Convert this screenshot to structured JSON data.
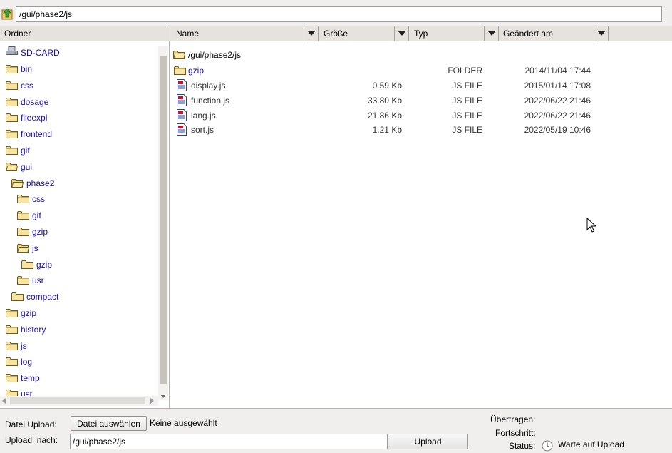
{
  "path_bar": {
    "current_path": "/gui/phase2/js"
  },
  "tree": {
    "header": "Ordner",
    "items": [
      {
        "label": "SD-CARD",
        "icon": "drive-icon"
      },
      {
        "label": "bin",
        "icon": "folder-icon"
      },
      {
        "label": "css",
        "icon": "folder-icon"
      },
      {
        "label": "dosage",
        "icon": "folder-icon"
      },
      {
        "label": "fileexpl",
        "icon": "folder-icon"
      },
      {
        "label": "frontend",
        "icon": "folder-icon"
      },
      {
        "label": "gif",
        "icon": "folder-icon"
      },
      {
        "label": "gui",
        "icon": "folder-open-icon"
      },
      {
        "label": "phase2",
        "icon": "folder-open-icon"
      },
      {
        "label": "css",
        "icon": "folder-icon"
      },
      {
        "label": "gif",
        "icon": "folder-icon"
      },
      {
        "label": "gzip",
        "icon": "folder-icon"
      },
      {
        "label": "js",
        "icon": "folder-open-icon"
      },
      {
        "label": "gzip",
        "icon": "folder-icon"
      },
      {
        "label": "usr",
        "icon": "folder-icon"
      },
      {
        "label": "compact",
        "icon": "folder-icon"
      },
      {
        "label": "gzip",
        "icon": "folder-icon"
      },
      {
        "label": "history",
        "icon": "folder-icon"
      },
      {
        "label": "js",
        "icon": "folder-icon"
      },
      {
        "label": "log",
        "icon": "folder-icon"
      },
      {
        "label": "temp",
        "icon": "folder-icon"
      },
      {
        "label": "usr",
        "icon": "folder-icon"
      }
    ]
  },
  "columns": {
    "name": "Name",
    "size": "Größe",
    "type": "Typ",
    "modified": "Geändert am"
  },
  "file_list": {
    "current_folder": "/gui/phase2/js",
    "rows": [
      {
        "name": "gzip",
        "size": "",
        "type": "FOLDER",
        "modified": "2014/11/04 17:44",
        "icon": "folder-icon"
      },
      {
        "name": "display.js",
        "size": "0.59 Kb",
        "type": "JS FILE",
        "modified": "2015/01/14 17:08",
        "icon": "js-file-icon"
      },
      {
        "name": "function.js",
        "size": "33.80 Kb",
        "type": "JS FILE",
        "modified": "2022/06/22 21:46",
        "icon": "js-file-icon"
      },
      {
        "name": "lang.js",
        "size": "21.86 Kb",
        "type": "JS FILE",
        "modified": "2022/06/22 21:46",
        "icon": "js-file-icon"
      },
      {
        "name": "sort.js",
        "size": "1.21 Kb",
        "type": "JS FILE",
        "modified": "2022/05/19 10:46",
        "icon": "js-file-icon"
      }
    ]
  },
  "upload": {
    "file_label": "Datei Upload:",
    "choose_button": "Datei auswählen",
    "no_file": "Keine ausgewählt",
    "target_label": "Upload  nach:",
    "target_path": "/gui/phase2/js",
    "upload_button": "Upload",
    "transferred_label": "Übertragen:",
    "progress_label": "Fortschritt:",
    "status_label": "Status:",
    "status_text": "Warte auf Upload"
  },
  "colors": {
    "link": "#1a0dab",
    "folder": "#f3d77a",
    "toolbar": "#f0efee",
    "header": "#e6e3de"
  }
}
